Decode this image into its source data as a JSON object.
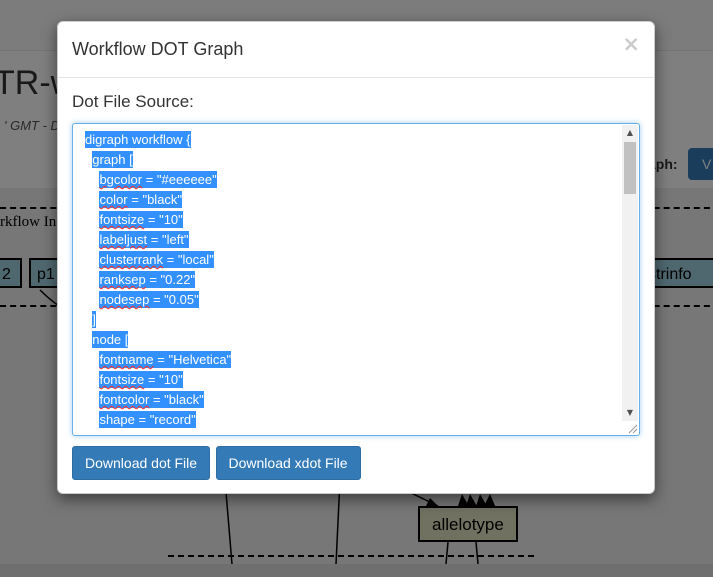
{
  "background": {
    "title_fragment": "TR-w",
    "subtitle_fragment": "' GMT - D",
    "graph_label": "aph:",
    "view_button": "V",
    "cluster_label": "rkflow In",
    "nodes": [
      "2",
      "p1",
      "strinfo"
    ],
    "allelotype_node": "allelotype",
    "colors": {
      "node_fill": "#9fd0de",
      "allelotype_fill": "#e2e2c4",
      "graph_bg": "#eeeeee"
    }
  },
  "modal": {
    "title": "Workflow DOT Graph",
    "close_label": "×",
    "source_label": "Dot File Source:",
    "code_lines": [
      {
        "indent": "",
        "text": "digraph workflow {"
      },
      {
        "indent": "  ",
        "text": "graph ["
      },
      {
        "indent": "    ",
        "key": "bgcolor",
        "rest": " = \"#eeeeee\""
      },
      {
        "indent": "    ",
        "key": "color",
        "rest": " = \"black\""
      },
      {
        "indent": "    ",
        "key": "fontsize",
        "rest": " = \"10\""
      },
      {
        "indent": "    ",
        "key": "labeljust",
        "rest": " = \"left\""
      },
      {
        "indent": "    ",
        "key": "clusterrank",
        "rest": " = \"local\""
      },
      {
        "indent": "    ",
        "key": "ranksep",
        "rest": " = \"0.22\""
      },
      {
        "indent": "    ",
        "key": "nodesep",
        "rest": " = \"0.05\""
      },
      {
        "indent": "  ",
        "text": "]"
      },
      {
        "indent": "  ",
        "text": "node ["
      },
      {
        "indent": "    ",
        "key": "fontname",
        "rest": " = \"Helvetica\""
      },
      {
        "indent": "    ",
        "key": "fontsize",
        "rest": " = \"10\""
      },
      {
        "indent": "    ",
        "key": "fontcolor",
        "rest": " = \"black\""
      },
      {
        "indent": "    ",
        "text": "shape = \"record\""
      }
    ],
    "download_dot_label": "Download dot File",
    "download_xdot_label": "Download xdot File",
    "colors": {
      "selection": "#3390ff",
      "button": "#337ab7"
    }
  }
}
